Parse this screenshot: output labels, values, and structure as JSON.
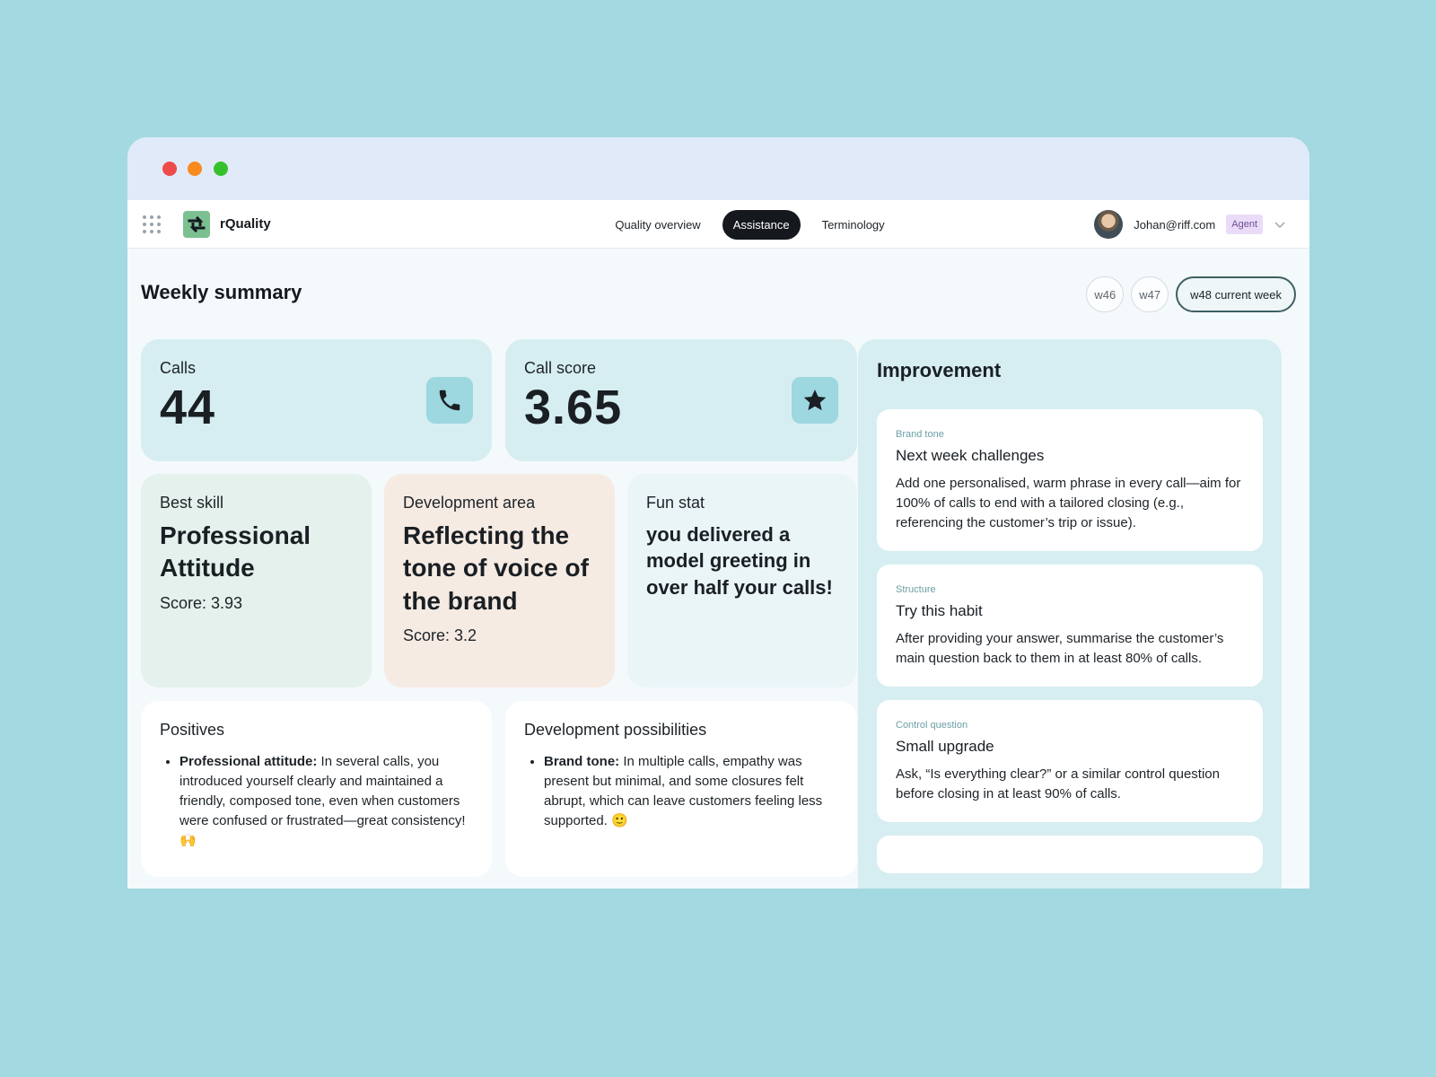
{
  "app": {
    "name": "rQuality"
  },
  "nav": {
    "tabs": [
      {
        "label": "Quality overview",
        "active": false
      },
      {
        "label": "Assistance",
        "active": true
      },
      {
        "label": "Terminology",
        "active": false
      }
    ]
  },
  "user": {
    "email": "Johan@riff.com",
    "role": "Agent"
  },
  "page": {
    "title": "Weekly summary",
    "weeks": [
      "w46",
      "w47",
      "w48 current week"
    ]
  },
  "stats": {
    "calls": {
      "label": "Calls",
      "value": "44",
      "icon": "phone-icon"
    },
    "call_score": {
      "label": "Call score",
      "value": "3.65",
      "icon": "star-icon"
    }
  },
  "highlights": {
    "best_skill": {
      "label": "Best skill",
      "heading": "Professional Attitude",
      "score": "Score: 3.93"
    },
    "development_area": {
      "label": "Development area",
      "heading": "Reflecting the tone of voice of the brand",
      "score": "Score: 3.2"
    },
    "fun_stat": {
      "label": "Fun stat",
      "text": "you delivered a model greeting in over half your calls!"
    }
  },
  "positives": {
    "title": "Positives",
    "items": [
      {
        "bold": "Professional attitude:",
        "text": " In several calls, you introduced yourself clearly and maintained a friendly, composed tone, even when customers were confused or frustrated—great consistency! 🙌"
      }
    ]
  },
  "dev_possibilities": {
    "title": "Development possibilities",
    "items": [
      {
        "bold": "Brand tone:",
        "text": " In multiple calls, empathy was present but minimal, and some closures felt abrupt, which can leave customers feeling less supported. 🙂"
      }
    ]
  },
  "improvement": {
    "title": "Improvement",
    "tips": [
      {
        "category": "Brand tone",
        "title": "Next week challenges",
        "body": "Add one personalised, warm phrase in every call—aim for 100% of calls to end with a tailored closing (e.g., referencing the customer’s trip or issue)."
      },
      {
        "category": "Structure",
        "title": "Try this habit",
        "body": "After providing your answer, summarise the customer’s main question back to them in at least 80% of calls."
      },
      {
        "category": "Control question",
        "title": "Small upgrade",
        "body": "Ask, “Is everything clear?” or a similar control question before closing in at least 90% of calls."
      }
    ]
  },
  "colors": {
    "background": "#a3d9e0",
    "stat_card": "#d6eef1",
    "best_skill_card": "#e4f1ec",
    "development_card": "#f6ebe3",
    "fun_card": "#eaf5f8",
    "accent_dark": "#15191d",
    "role_badge": "#eadcf8"
  }
}
